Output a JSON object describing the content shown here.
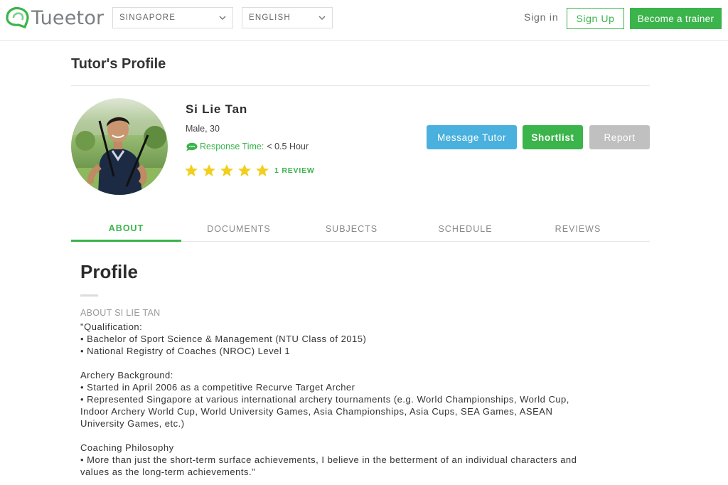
{
  "header": {
    "logo_text": "Tueetor",
    "country_select": "SINGAPORE",
    "language_select": "ENGLISH",
    "sign_in": "Sign in",
    "sign_up": "Sign Up",
    "become_trainer": "Become a trainer"
  },
  "page_title": "Tutor's Profile",
  "tutor": {
    "name": "Si Lie Tan",
    "meta": "Male, 30",
    "response_label": "Response Time:",
    "response_value": "< 0.5 Hour",
    "rating": 5,
    "rating_max": 5,
    "review_link": "1 REVIEW"
  },
  "actions": {
    "message": "Message Tutor",
    "shortlist": "Shortlist",
    "report": "Report"
  },
  "tabs": [
    "ABOUT",
    "DOCUMENTS",
    "SUBJECTS",
    "SCHEDULE",
    "REVIEWS"
  ],
  "active_tab": "ABOUT",
  "profile": {
    "title": "Profile",
    "about_label": "ABOUT SI LIE TAN",
    "lines": [
      "\"Qualification:",
      "• Bachelor of Sport Science & Management (NTU Class of 2015)",
      "• National Registry of Coaches (NROC) Level 1",
      "",
      "Archery Background:",
      "• Started in April 2006 as a competitive Recurve Target Archer",
      "• Represented Singapore at various international archery tournaments (e.g. World Championships, World Cup,",
      "Indoor Archery World Cup, World University Games, Asia Championships, Asia Cups, SEA Games, ASEAN",
      "University Games, etc.)",
      "",
      "Coaching Philosophy",
      "• More than just the short-term surface achievements, I believe in the betterment of an individual characters and",
      "values as the long-term achievements.\""
    ]
  },
  "colors": {
    "brand_green": "#3ab44b",
    "message_blue": "#4ab0dd",
    "report_gray": "#c0c0c0",
    "star_yellow": "#f2cf1f"
  },
  "icons": {
    "logo": "tueetor-logo-icon",
    "chevron": "chevron-down-icon",
    "response": "chat-bubble-icon",
    "star": "star-icon"
  }
}
